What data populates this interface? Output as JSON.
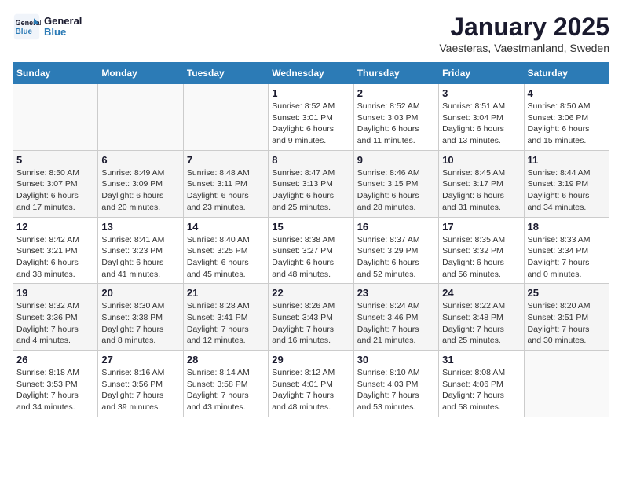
{
  "logo": {
    "line1": "General",
    "line2": "Blue"
  },
  "title": "January 2025",
  "subtitle": "Vaesteras, Vaestmanland, Sweden",
  "weekdays": [
    "Sunday",
    "Monday",
    "Tuesday",
    "Wednesday",
    "Thursday",
    "Friday",
    "Saturday"
  ],
  "weeks": [
    [
      {
        "day": "",
        "info": ""
      },
      {
        "day": "",
        "info": ""
      },
      {
        "day": "",
        "info": ""
      },
      {
        "day": "1",
        "info": "Sunrise: 8:52 AM\nSunset: 3:01 PM\nDaylight: 6 hours\nand 9 minutes."
      },
      {
        "day": "2",
        "info": "Sunrise: 8:52 AM\nSunset: 3:03 PM\nDaylight: 6 hours\nand 11 minutes."
      },
      {
        "day": "3",
        "info": "Sunrise: 8:51 AM\nSunset: 3:04 PM\nDaylight: 6 hours\nand 13 minutes."
      },
      {
        "day": "4",
        "info": "Sunrise: 8:50 AM\nSunset: 3:06 PM\nDaylight: 6 hours\nand 15 minutes."
      }
    ],
    [
      {
        "day": "5",
        "info": "Sunrise: 8:50 AM\nSunset: 3:07 PM\nDaylight: 6 hours\nand 17 minutes."
      },
      {
        "day": "6",
        "info": "Sunrise: 8:49 AM\nSunset: 3:09 PM\nDaylight: 6 hours\nand 20 minutes."
      },
      {
        "day": "7",
        "info": "Sunrise: 8:48 AM\nSunset: 3:11 PM\nDaylight: 6 hours\nand 23 minutes."
      },
      {
        "day": "8",
        "info": "Sunrise: 8:47 AM\nSunset: 3:13 PM\nDaylight: 6 hours\nand 25 minutes."
      },
      {
        "day": "9",
        "info": "Sunrise: 8:46 AM\nSunset: 3:15 PM\nDaylight: 6 hours\nand 28 minutes."
      },
      {
        "day": "10",
        "info": "Sunrise: 8:45 AM\nSunset: 3:17 PM\nDaylight: 6 hours\nand 31 minutes."
      },
      {
        "day": "11",
        "info": "Sunrise: 8:44 AM\nSunset: 3:19 PM\nDaylight: 6 hours\nand 34 minutes."
      }
    ],
    [
      {
        "day": "12",
        "info": "Sunrise: 8:42 AM\nSunset: 3:21 PM\nDaylight: 6 hours\nand 38 minutes."
      },
      {
        "day": "13",
        "info": "Sunrise: 8:41 AM\nSunset: 3:23 PM\nDaylight: 6 hours\nand 41 minutes."
      },
      {
        "day": "14",
        "info": "Sunrise: 8:40 AM\nSunset: 3:25 PM\nDaylight: 6 hours\nand 45 minutes."
      },
      {
        "day": "15",
        "info": "Sunrise: 8:38 AM\nSunset: 3:27 PM\nDaylight: 6 hours\nand 48 minutes."
      },
      {
        "day": "16",
        "info": "Sunrise: 8:37 AM\nSunset: 3:29 PM\nDaylight: 6 hours\nand 52 minutes."
      },
      {
        "day": "17",
        "info": "Sunrise: 8:35 AM\nSunset: 3:32 PM\nDaylight: 6 hours\nand 56 minutes."
      },
      {
        "day": "18",
        "info": "Sunrise: 8:33 AM\nSunset: 3:34 PM\nDaylight: 7 hours\nand 0 minutes."
      }
    ],
    [
      {
        "day": "19",
        "info": "Sunrise: 8:32 AM\nSunset: 3:36 PM\nDaylight: 7 hours\nand 4 minutes."
      },
      {
        "day": "20",
        "info": "Sunrise: 8:30 AM\nSunset: 3:38 PM\nDaylight: 7 hours\nand 8 minutes."
      },
      {
        "day": "21",
        "info": "Sunrise: 8:28 AM\nSunset: 3:41 PM\nDaylight: 7 hours\nand 12 minutes."
      },
      {
        "day": "22",
        "info": "Sunrise: 8:26 AM\nSunset: 3:43 PM\nDaylight: 7 hours\nand 16 minutes."
      },
      {
        "day": "23",
        "info": "Sunrise: 8:24 AM\nSunset: 3:46 PM\nDaylight: 7 hours\nand 21 minutes."
      },
      {
        "day": "24",
        "info": "Sunrise: 8:22 AM\nSunset: 3:48 PM\nDaylight: 7 hours\nand 25 minutes."
      },
      {
        "day": "25",
        "info": "Sunrise: 8:20 AM\nSunset: 3:51 PM\nDaylight: 7 hours\nand 30 minutes."
      }
    ],
    [
      {
        "day": "26",
        "info": "Sunrise: 8:18 AM\nSunset: 3:53 PM\nDaylight: 7 hours\nand 34 minutes."
      },
      {
        "day": "27",
        "info": "Sunrise: 8:16 AM\nSunset: 3:56 PM\nDaylight: 7 hours\nand 39 minutes."
      },
      {
        "day": "28",
        "info": "Sunrise: 8:14 AM\nSunset: 3:58 PM\nDaylight: 7 hours\nand 43 minutes."
      },
      {
        "day": "29",
        "info": "Sunrise: 8:12 AM\nSunset: 4:01 PM\nDaylight: 7 hours\nand 48 minutes."
      },
      {
        "day": "30",
        "info": "Sunrise: 8:10 AM\nSunset: 4:03 PM\nDaylight: 7 hours\nand 53 minutes."
      },
      {
        "day": "31",
        "info": "Sunrise: 8:08 AM\nSunset: 4:06 PM\nDaylight: 7 hours\nand 58 minutes."
      },
      {
        "day": "",
        "info": ""
      }
    ]
  ]
}
